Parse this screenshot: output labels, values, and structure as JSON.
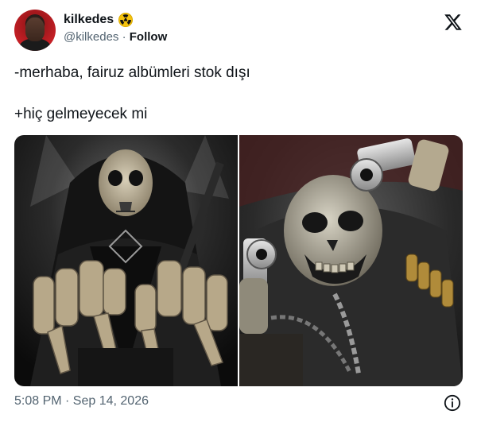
{
  "user": {
    "display_name": "kilkedes",
    "badge_icon": "radioactive-icon",
    "handle": "@kilkedes",
    "separator": " · ",
    "follow_label": "Follow"
  },
  "tweet": {
    "lines": [
      "-merhaba, fairuz albümleri stok dışı",
      "+hiç gelmeyecek mi"
    ]
  },
  "media": {
    "count": 2,
    "images": [
      "skeleton-rock-image",
      "skeleton-revolvers-image"
    ]
  },
  "footer": {
    "timestamp": "5:08 PM · Sep 14, 2026"
  },
  "colors": {
    "text": "#0f1419",
    "secondary": "#536471",
    "badge": "#f4c20d"
  }
}
